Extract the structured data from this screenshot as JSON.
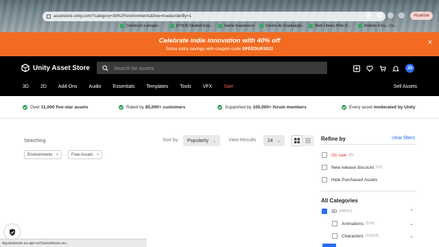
{
  "browser": {
    "url": "assetstore.unity.com/?category=3d%2Fenvironments&free=true&orderBy=1",
    "update_button": "Atualizar",
    "bookmarks": [
      "Construct a progra...",
      "[VTEX] Student Exp...",
      "Game Experience",
      "Centro de Graduação...",
      "Web Library Brito D...",
      "Módulo 4 Gu...Co..."
    ]
  },
  "promo": {
    "headline": "Celebrate indie innovation with 40% off",
    "sub_prefix": "Score extra savings with coupon code ",
    "coupon": "SPEEDUP2022",
    "close": "×"
  },
  "header": {
    "logo_text": "Unity Asset Store",
    "search_placeholder": "Search for assets",
    "avatar_initials": "JD",
    "nav": [
      "3D",
      "2D",
      "Add-Ons",
      "Audio",
      "Essentials",
      "Templates",
      "Tools",
      "VFX",
      "Sale"
    ],
    "sell": "Sell Assets"
  },
  "trust": [
    {
      "pre": "Over ",
      "bold": "11,000 five-star assets",
      "post": ""
    },
    {
      "pre": "Rated by ",
      "bold": "85,000+ customers",
      "post": ""
    },
    {
      "pre": "Supported by ",
      "bold": "100,000+ forum members",
      "post": ""
    },
    {
      "pre": "Every asset ",
      "bold": "moderated by Unity",
      "post": ""
    }
  ],
  "results": {
    "searching_label": "Searching",
    "filters": [
      "Environments",
      "Free Assets"
    ],
    "sort_label": "Sort by",
    "sort_value": "Popularity",
    "view_label": "View Results",
    "view_value": "24"
  },
  "refine": {
    "title": "Refine by",
    "clear": "clear filters",
    "options": [
      {
        "label": "On sale",
        "count": "(0)",
        "checked": false
      },
      {
        "label": "New release discount",
        "count": "(11)",
        "checked": false
      },
      {
        "label": "Hide Purchased Assets",
        "count": "",
        "checked": false
      }
    ],
    "all_categories": "All Categories",
    "categories": [
      {
        "label": "3D",
        "count": "(44031)",
        "checked": true
      },
      {
        "label": "Animations",
        "count": "(576)",
        "checked": false
      },
      {
        "label": "Characters",
        "count": "(13024)",
        "checked": false
      }
    ]
  },
  "status_text": "Aguardando eu-api-vcif.kameleoon.eu...",
  "colors": {
    "promo": "#f26b21",
    "header": "#000000",
    "accent": "#2a6df4",
    "sale": "#f05a4a",
    "check": "#2a9a4f"
  }
}
